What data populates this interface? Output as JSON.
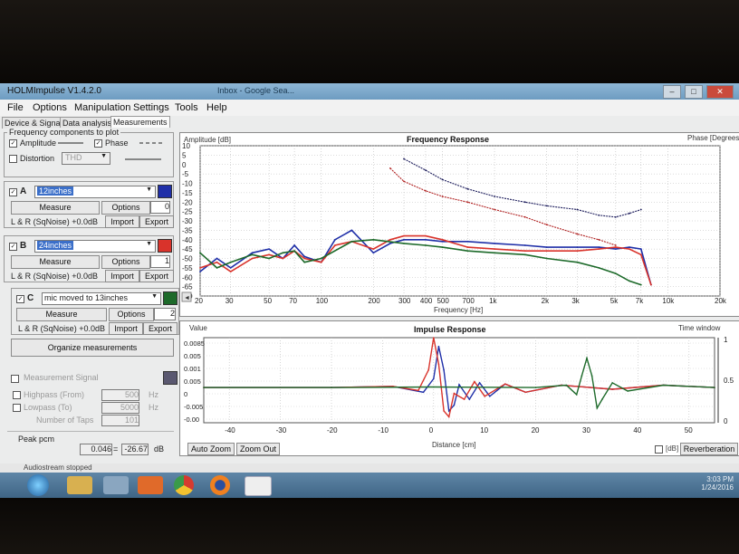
{
  "window": {
    "title": "HOLMImpulse  V1.4.2.0",
    "background_tabs": [
      "Inbox - Google Sea..."
    ]
  },
  "menu": [
    "File",
    "Options",
    "Manipulation",
    "Settings",
    "Tools",
    "Help"
  ],
  "tabs": [
    "Device & Signal",
    "Data analysis",
    "Measurements"
  ],
  "active_tab": "Measurements",
  "freq_components": {
    "title": "Frequency components to plot",
    "amplitude_label": "Amplitude",
    "amplitude_checked": true,
    "phase_label": "Phase",
    "phase_checked": true,
    "distortion_label": "Distortion",
    "distortion_checked": false,
    "distortion_select": "THD"
  },
  "measurements": [
    {
      "letter": "A",
      "name": "12inches",
      "selected": true,
      "color": "#1f2fa8",
      "measure_label": "Measure",
      "options_label": "Options",
      "count": "0",
      "info": "L & R (SqNoise) +0.0dB",
      "import_label": "Import",
      "export_label": "Export"
    },
    {
      "letter": "B",
      "name": "24inches",
      "selected": true,
      "color": "#d9332b",
      "measure_label": "Measure",
      "options_label": "Options",
      "count": "1",
      "info": "L & R (SqNoise) +0.0dB",
      "import_label": "Import",
      "export_label": "Export"
    },
    {
      "letter": "C",
      "name": "mic moved to 13inches",
      "selected": false,
      "color": "#1d6a2a",
      "measure_label": "Measure",
      "options_label": "Options",
      "count": "2",
      "info": "L & R (SqNoise) +0.0dB",
      "import_label": "Import",
      "export_label": "Export"
    }
  ],
  "organize_label": "Organize measurements",
  "signal": {
    "title": "Measurement Signal",
    "highpass_label": "Highpass (From)",
    "highpass_value": "500",
    "lowpass_label": "Lowpass (To)",
    "lowpass_value": "5000",
    "taps_label": "Number of Taps",
    "taps_value": "101",
    "unit_hz": "Hz",
    "peak_label": "Peak pcm",
    "peak_value": "0.046",
    "peak_eq": "=",
    "peak_db": "-26.67",
    "peak_unit": "dB"
  },
  "status": "Audiostream stopped",
  "tray": {
    "time": "3:03 PM",
    "date": "1/24/2016"
  },
  "colors": {
    "series_a": "#1f2fa8",
    "series_b": "#d9332b",
    "series_c": "#1d6a2a",
    "taskbar": "#4d7496"
  },
  "taskbar_icons": [
    "start-orb",
    "file-explorer",
    "libraries",
    "media",
    "chrome",
    "firefox",
    "holmimpulse"
  ],
  "chart_data": [
    {
      "type": "line",
      "title": "Frequency Response",
      "ylabel": "Amplitude [dB]",
      "y2label": "Phase [Degrees]",
      "xlabel": "Frequency [Hz]",
      "xscale": "log",
      "xlim": [
        20,
        20000
      ],
      "ylim": [
        -70,
        10
      ],
      "x_ticks": [
        "20",
        "30",
        "50",
        "70",
        "100",
        "200",
        "300",
        "400",
        "500",
        "700",
        "1k",
        "2k",
        "3k",
        "5k",
        "7k",
        "10k",
        "20k"
      ],
      "x_tick_values": [
        20,
        30,
        50,
        70,
        100,
        200,
        300,
        400,
        500,
        700,
        1000,
        2000,
        3000,
        5000,
        7000,
        10000,
        20000
      ],
      "y_ticks": [
        10,
        5,
        0,
        -5,
        -10,
        -15,
        -20,
        -25,
        -30,
        -35,
        -40,
        -45,
        -50,
        -55,
        -60,
        -65,
        -70
      ],
      "grid": true,
      "series": [
        {
          "x": [
            20,
            25,
            30,
            40,
            50,
            60,
            70,
            80,
            100,
            120,
            150,
            200,
            250,
            300,
            400,
            500,
            700,
            1000,
            1500,
            2000,
            3000,
            4000,
            5000,
            6000,
            7000,
            8000
          ],
          "values": [
            -57,
            -50,
            -55,
            -47,
            -45,
            -50,
            -43,
            -49,
            -52,
            -40,
            -35,
            -47,
            -42,
            -40,
            -40,
            -41,
            -41,
            -42,
            -43,
            -44,
            -44,
            -44,
            -45,
            -44,
            -45,
            -64
          ]
        },
        {
          "x": [
            20,
            25,
            30,
            40,
            50,
            60,
            70,
            80,
            100,
            120,
            150,
            200,
            250,
            300,
            400,
            500,
            700,
            1000,
            1500,
            2000,
            3000,
            4000,
            5000,
            6000,
            7000,
            8000
          ],
          "values": [
            -55,
            -52,
            -57,
            -50,
            -48,
            -50,
            -46,
            -50,
            -52,
            -43,
            -41,
            -45,
            -40,
            -38,
            -38,
            -40,
            -44,
            -45,
            -46,
            -46,
            -46,
            -45,
            -44,
            -45,
            -48,
            -64
          ]
        },
        {
          "x": [
            20,
            25,
            30,
            40,
            50,
            60,
            70,
            80,
            100,
            150,
            200,
            300,
            400,
            500,
            700,
            1000,
            1500,
            2000,
            3000,
            4000,
            5000,
            6000,
            7000
          ],
          "values": [
            -47,
            -55,
            -52,
            -48,
            -50,
            -47,
            -46,
            -52,
            -50,
            -41,
            -40,
            -42,
            -43,
            -44,
            -46,
            -47,
            -48,
            -50,
            -52,
            -55,
            -58,
            -62,
            -64
          ]
        },
        {
          "x": [
            300,
            400,
            500,
            700,
            1000,
            1500,
            2000,
            3000,
            4000,
            5000,
            6000,
            7000
          ],
          "values": [
            3,
            -3,
            -8,
            -13,
            -17,
            -20,
            -22,
            -24,
            -27,
            -28,
            -26,
            -24
          ]
        },
        {
          "x": [
            250,
            300,
            400,
            500,
            700,
            1000,
            1500,
            2000,
            3000,
            4000,
            5000
          ],
          "values": [
            -2,
            -9,
            -14,
            -17,
            -20,
            -24,
            -28,
            -32,
            -37,
            -40,
            -43
          ]
        }
      ]
    },
    {
      "type": "line",
      "title": "Impulse Response",
      "ylabel": "Value",
      "y2label": "Time window",
      "xlabel": "Distance [cm]",
      "xlim": [
        -45,
        55
      ],
      "ylim": [
        -0.006,
        0.0085
      ],
      "x_ticks": [
        "-40",
        "-30",
        "-20",
        "-10",
        "0",
        "10",
        "20",
        "30",
        "40",
        "50"
      ],
      "y_ticks": [
        "0.0085",
        "0.005",
        "0.001",
        "0.005",
        "0",
        "-0.005",
        "-0.00"
      ],
      "y2_ticks": [
        "1",
        "0.5",
        "0"
      ],
      "series": [
        {
          "x": [
            -45,
            -20,
            -8,
            -2,
            0,
            1,
            2,
            3,
            4,
            5,
            7,
            9,
            11,
            14,
            18,
            25,
            35,
            45,
            55
          ],
          "values": [
            0,
            0,
            0.0002,
            -0.0008,
            0.0015,
            0.007,
            0.003,
            -0.004,
            -0.003,
            0.0005,
            -0.002,
            0.0008,
            -0.0015,
            0.0006,
            -0.0008,
            0.0004,
            -0.0003,
            0.0004,
            0
          ]
        },
        {
          "x": [
            -45,
            -20,
            -8,
            -3,
            -1,
            0,
            1,
            2,
            3,
            4,
            6,
            8,
            10,
            14,
            18,
            25,
            35,
            45,
            55
          ],
          "values": [
            0,
            0,
            0.0002,
            -0.0005,
            0.003,
            0.0085,
            0.004,
            -0.004,
            -0.005,
            -0.001,
            -0.002,
            0.001,
            -0.0015,
            0.0006,
            -0.0008,
            0.0004,
            -0.0003,
            0.0004,
            0
          ]
        },
        {
          "x": [
            -45,
            -20,
            0,
            20,
            26,
            28,
            29,
            30,
            31,
            32,
            33,
            35,
            38,
            45,
            55
          ],
          "values": [
            0,
            0,
            0.0001,
            0,
            0.0004,
            -0.0012,
            0.002,
            0.005,
            0.002,
            -0.0035,
            -0.002,
            0.0008,
            -0.0006,
            0.0004,
            0
          ]
        }
      ]
    }
  ],
  "impulse_buttons": {
    "auto_zoom": "Auto Zoom",
    "zoom_out": "Zoom Out",
    "db_label": "[dB]",
    "reverberation": "Reverberation"
  }
}
